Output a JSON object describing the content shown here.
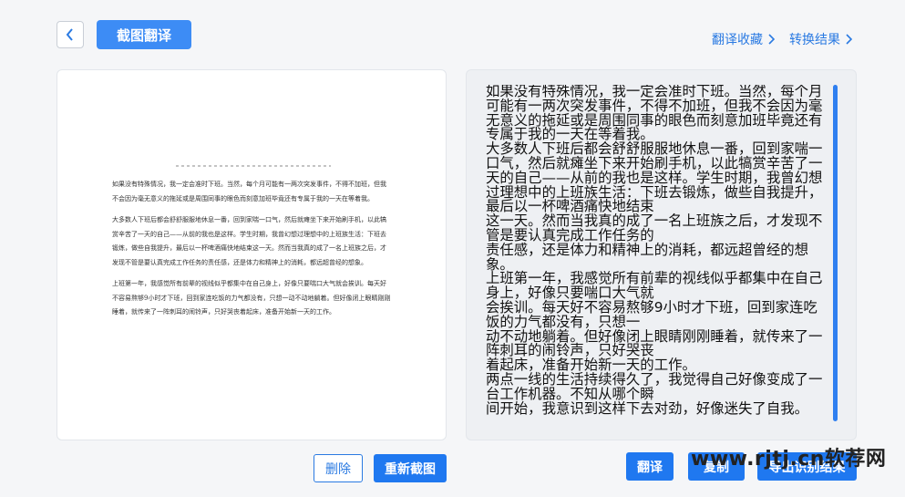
{
  "header": {
    "back_icon": "chevron-left-icon",
    "title": "截图翻译",
    "links": [
      {
        "label": "翻译收藏",
        "icon": "chevron-right-icon"
      },
      {
        "label": "转换结果",
        "icon": "chevron-right-icon"
      }
    ]
  },
  "source_image": {
    "paragraphs": [
      "如果没有特殊情况，我一定会准时下班。当然，每个月可能有一两次突发事件，不得不加班，但我不会因为毫无意义的拖延或是周围同事的眼色而刻意加班毕竟还有专属于我的一天在等着我。",
      "大多数人下班后都会舒舒服服地休息一番，回到家喘一口气，然后就瘫坐下来开始刷手机，以此犒赏辛苦了一天的自己——从前的我也是这样。学生时期，我曾幻想过理想中的上班族生活：下班去锻炼，做些自我提升，最后以一杯啤酒痛快地结束这一天。然而当我真的成了一名上班族之后，才发现不管是要认真完成工作任务的责任感，还是体力和精神上的消耗，都远超曾经的想象。",
      "上班第一年，我感觉所有前辈的视线似乎都集中在自己身上，好像只要喘口大气就会挨训。每天好不容易熬够9小时才下班，回到家连吃饭的力气都没有，只想一动不动地躺着。但好像闭上眼睛刚刚睡着，就传来了一阵刺耳的闹铃声，只好哭丧着起床，准备开始新一天的工作。"
    ]
  },
  "result": {
    "lines": [
      "如果没有特殊情况，我一定会准时下班。当然，每个月可能有一两次突发事件，不得不加班，但我不会因为毫无意义的拖延或是周围同事的眼色而刻意加班毕竟还有专属于我的一天在等着我。",
      "大多数人下班后都会舒舒服服地休息一番，回到家喘一口气，然后就瘫坐下来开始刷手机，以此犒赏辛苦了一天的自己——从前的我也是这样。学生时期，我曾幻想",
      "过理想中的上班族生活：下班去锻炼，做些自我提升，最后以一杯啤酒痛快地结束",
      "这一天。然而当我真的成了一名上班族之后，才发现不管是要认真完成工作任务的",
      "责任感，还是体力和精神上的消耗，都远超曾经的想象。",
      "上班第一年，我感觉所有前辈的视线似乎都集中在自己身上，好像只要喘口大气就",
      "会挨训。每天好不容易熬够9小时才下班，回到家连吃饭的力气都没有，只想一",
      "动不动地躺着。但好像闭上眼睛刚刚睡着，就传来了一阵刺耳的闹铃声，只好哭丧",
      "着起床，准备开始新一天的工作。",
      "两点一线的生活持续得久了，我觉得自己好像变成了一台工作机器。不知从哪个瞬",
      "间开始，我意识到这样下去对劲，好像迷失了自我。"
    ]
  },
  "buttons": {
    "delete": "删除",
    "recapture": "重新截图",
    "translate": "翻译",
    "copy": "复制",
    "export": "导出识别结果"
  },
  "watermark": "www.rjtj.cn软荐网",
  "colors": {
    "accent": "#1f78f0",
    "link": "#2a7ae2"
  }
}
